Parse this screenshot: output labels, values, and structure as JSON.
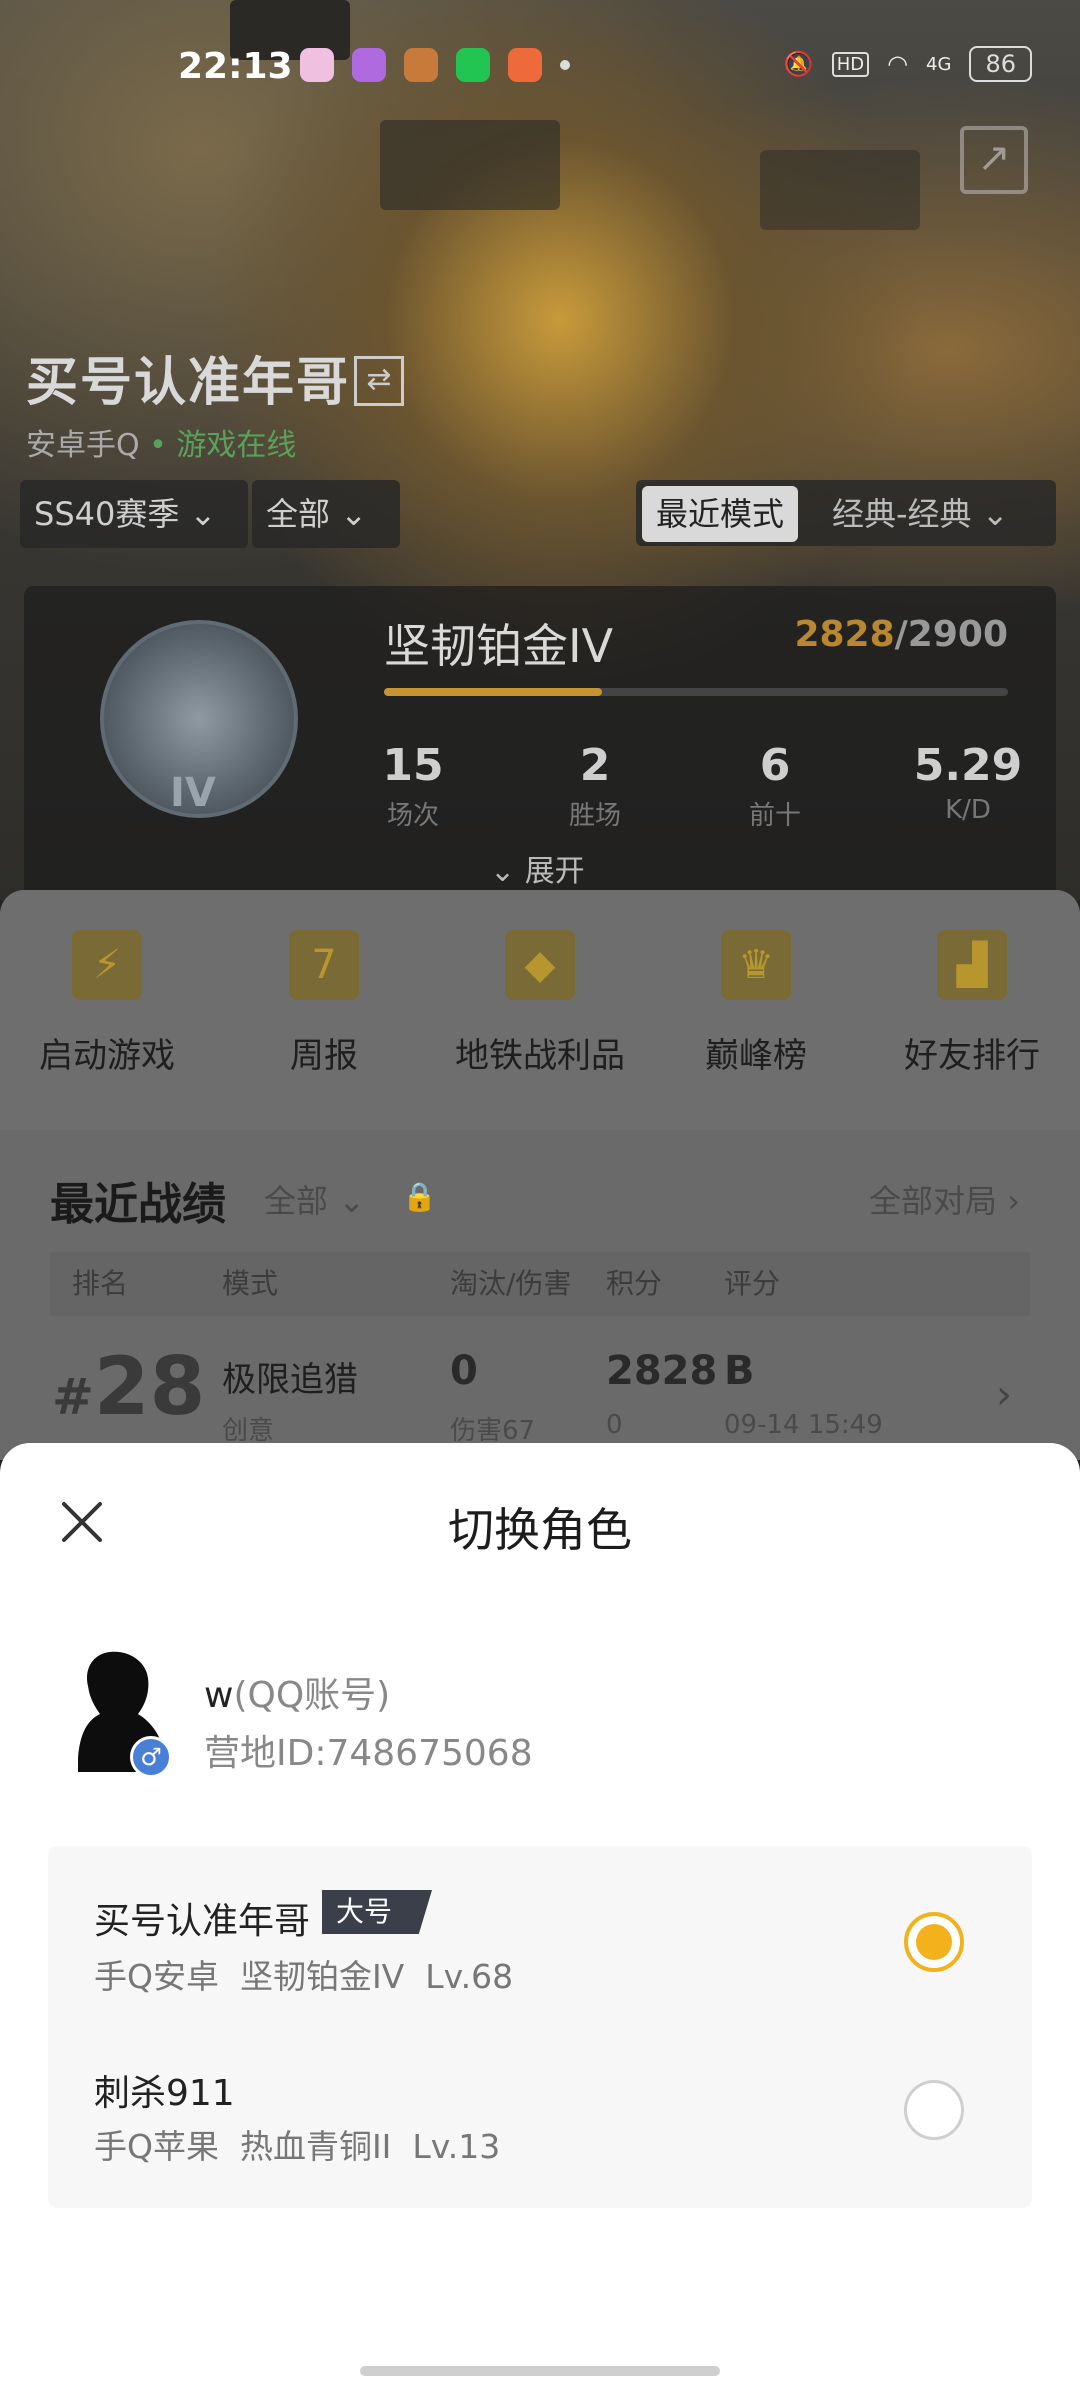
{
  "status_bar": {
    "time": "22:13",
    "app_icons": [
      "#f0c0e0",
      "#b06adf",
      "#c77a3a",
      "#23c552",
      "#ef6a3a"
    ],
    "battery": "86",
    "network": "4G"
  },
  "profile": {
    "name": "买号认准年哥",
    "platform": "安卓手Q",
    "online_status": "游戏在线",
    "season": "SS40赛季",
    "filter": "全部",
    "mode_tab_active": "最近模式",
    "mode_tab_other": "经典-经典"
  },
  "rank": {
    "tier_roman": "IV",
    "name": "坚韧铂金IV",
    "score_current": "2828",
    "score_sep_target": "/2900",
    "progress": 0.35,
    "stats": [
      {
        "value": "15",
        "label": "场次"
      },
      {
        "value": "2",
        "label": "胜场"
      },
      {
        "value": "6",
        "label": "前十"
      },
      {
        "value": "5.29",
        "label": "K/D"
      }
    ],
    "expand_label": "展开"
  },
  "quick_actions": [
    {
      "label": "启动游戏",
      "icon": "lightning-icon"
    },
    {
      "label": "周报",
      "icon": "calendar-icon",
      "glyph": "7"
    },
    {
      "label": "地铁战利品",
      "icon": "metro-shield-icon"
    },
    {
      "label": "巅峰榜",
      "icon": "peak-shield-icon"
    },
    {
      "label": "好友排行",
      "icon": "podium-icon"
    }
  ],
  "records": {
    "title": "最近战绩",
    "filter": "全部",
    "all_games": "全部对局",
    "headers": [
      "排名",
      "模式",
      "淘汰/伤害",
      "积分",
      "评分"
    ],
    "row": {
      "rank_prefix": "#",
      "rank": "28",
      "mode": "极限追猎",
      "mode_sub": "创意",
      "kills": "0",
      "damage": "伤害67",
      "points": "2828",
      "points_sub": "0",
      "grade": "B",
      "time": "09-14 15:49"
    }
  },
  "modal": {
    "title": "切换角色",
    "account": {
      "name": "w",
      "account_type": "(QQ账号)",
      "camp_id": "营地ID:748675068"
    },
    "roles": [
      {
        "name": "买号认准年哥",
        "badge": "大号",
        "sub": "手Q安卓  坚韧铂金IV  Lv.68",
        "selected": true
      },
      {
        "name": "刺杀911",
        "sub": "手Q苹果  热血青铜II  Lv.13",
        "selected": false
      }
    ]
  }
}
